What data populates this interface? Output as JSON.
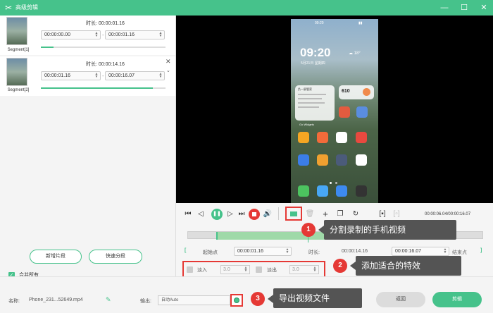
{
  "window": {
    "title": "高级剪辑",
    "logo_glyph": "✂"
  },
  "segments": [
    {
      "name": "Segment[1]",
      "duration_label": "时长: 00:00:01.16",
      "start": "00:00:00.00",
      "end": "00:00:01.16",
      "progress": 0.1
    },
    {
      "name": "Segment[2]",
      "duration_label": "时长: 00:00:14.16",
      "start": "00:00:01.16",
      "end": "00:00:16.07",
      "progress": 0.9
    }
  ],
  "left_buttons": {
    "new_segment": "新增片段",
    "quick_split": "快速分段"
  },
  "merge_all": {
    "label": "合并所有",
    "checked": true
  },
  "phone": {
    "status_time": "09:20",
    "clock": "09:20",
    "date": "5月21日 星期四",
    "weather": "610",
    "widget_title": "负一屏管家",
    "widget_caption": "Go Widgets",
    "dock_apps": [
      "电话",
      "信息",
      "浏览器",
      "相机"
    ]
  },
  "player": {
    "time_readout": "00:00:06.04/00:00:16.07"
  },
  "trim": {
    "start_label": "起始点",
    "start_time": "00:00:01.16",
    "duration_label": "时长:",
    "duration": "00:00:14.16",
    "end_time": "00:00:16.07",
    "end_label": "结束点",
    "bracket_open": "[",
    "bracket_close": "]"
  },
  "fade": {
    "in_label": "淡入",
    "in_value": "3.0",
    "out_label": "淡出",
    "out_value": "3.0"
  },
  "footer": {
    "name_label": "名称:",
    "file_name": "Phone_231...52649.mp4",
    "output_label": "输出:",
    "output_value": "自动Auto",
    "back": "返回",
    "cut": "剪辑"
  },
  "callouts": [
    {
      "num": "1",
      "text": "分割录制的手机视频"
    },
    {
      "num": "2",
      "text": "添加适合的特效"
    },
    {
      "num": "3",
      "text": "导出视频文件"
    }
  ],
  "colors": {
    "accent": "#46c28b",
    "callout": "#e53935",
    "callout_box": "#545454"
  }
}
